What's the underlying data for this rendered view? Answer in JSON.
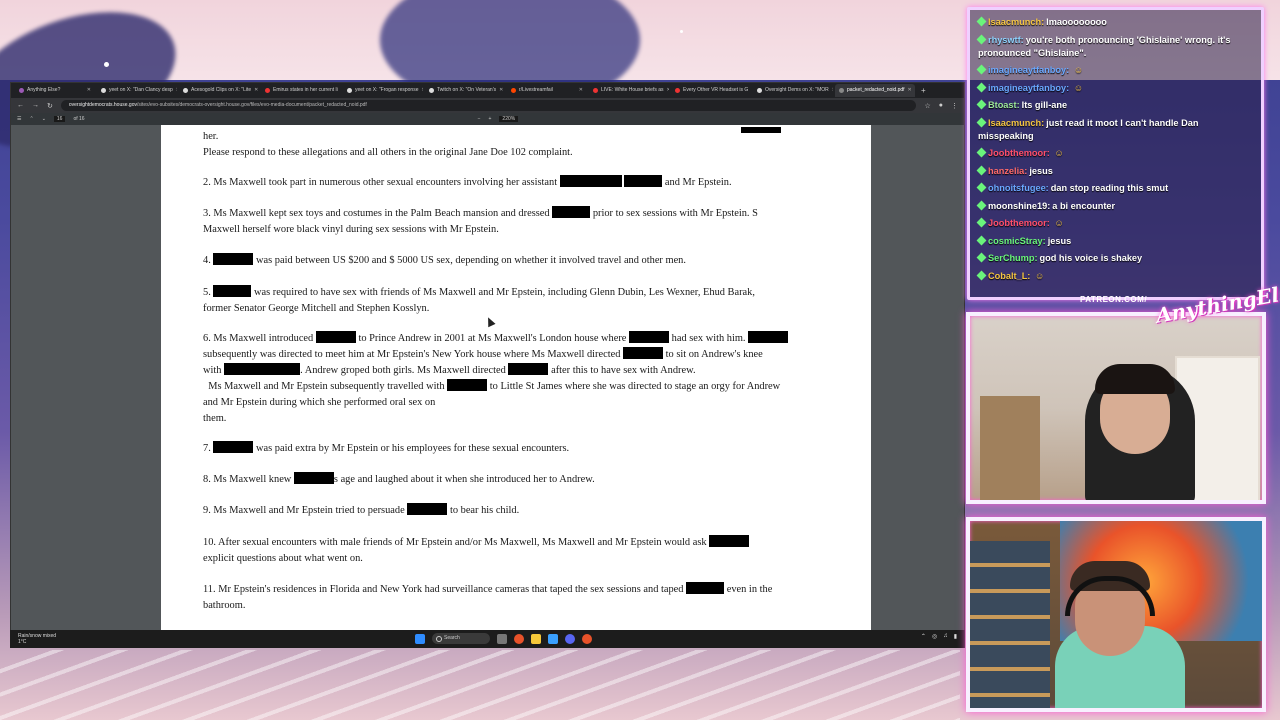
{
  "browser": {
    "tabs": [
      {
        "label": "Anything Else?",
        "color": "#9b59b6"
      },
      {
        "label": "yeet on X: \"Dan Clancy desp",
        "color": "#ddd"
      },
      {
        "label": "Acesogold Clips on X: \"Lite",
        "color": "#ddd"
      },
      {
        "label": "Emirus states in her current li",
        "color": "#e33"
      },
      {
        "label": "yeet on X: \"Frogan response",
        "color": "#ddd"
      },
      {
        "label": "Twitch on X: \"On Veteran's",
        "color": "#ddd"
      },
      {
        "label": "r/Livestreamfail",
        "color": "#ff4500"
      },
      {
        "label": "LIVE: White House briefs as",
        "color": "#e33"
      },
      {
        "label": "Every Other VR Headset is G",
        "color": "#e33"
      },
      {
        "label": "Oversight Dems on X: \"MOR",
        "color": "#ddd"
      },
      {
        "label": "packet_redacted_noid.pdf",
        "color": "#888"
      }
    ],
    "url_domain": "oversightdemocrats.house.gov",
    "url_path": "/sites/evo-subsites/democrats-oversight.house.gov/files/evo-media-document/packet_redacted_noid.pdf",
    "page_current": "16",
    "page_total": "of 16",
    "zoom": "220%"
  },
  "document": {
    "p0a": "her.",
    "p0b": "Please respond to these allegations and all others in the original Jane Doe 102 complaint.",
    "p2a": "2.  Ms Maxwell took part in numerous other sexual encounters involving her assistant",
    "p2b": "and Mr Epstein.",
    "p3a": "3.  Ms Maxwell kept sex toys and costumes in the Palm Beach mansion and dressed",
    "p3b": "prior to sex sessions with Mr Epstein. S",
    "p3c": "Maxwell herself wore black vinyl during sex sessions with Mr Epstein.",
    "p4a": "4.",
    "p4b": "was paid between US $200 and $ 5000 US sex, depending on whether it involved travel and other men.",
    "p5a": "5.",
    "p5b": "was required to have sex with friends of Ms Maxwell  and Mr Epstein, including Glenn Dubin, Les Wexner, Ehud Barak,",
    "p5c": "former Senator George Mitchell and Stephen Kosslyn.",
    "p6a": "6. Ms Maxwell introduced",
    "p6b": "to Prince Andrew in 2001 at Ms Maxwell's London house where",
    "p6c": "had sex with him.",
    "p6d": "subsequently was directed to meet him at Mr Epstein's New York  house where Ms Maxwell directed",
    "p6e": "to sit on Andrew's knee",
    "p6f": "with",
    "p6g": ". Andrew groped both girls. Ms Maxwell directed",
    "p6h": "after this to have sex with Andrew.",
    "p6i": "Ms Maxwell and Mr Epstein subsequently travelled with",
    "p6j": "to Little St James where she was directed to stage an orgy for Andrew",
    "p6k": "and Mr Epstein during which she performed oral sex on",
    "p6l": "them.",
    "p7a": "7.",
    "p7b": "was paid extra by Mr Epstein or his employees for these sexual encounters.",
    "p8a": "8. Ms Maxwell knew",
    "p8b": "s age and laughed about it when she introduced her to Andrew.",
    "p9a": "9. Ms Maxwell and Mr Epstein tried to persuade",
    "p9b": "to bear his child.",
    "p10a": "10.  After sexual encounters with male friends of Mr Epstein and/or Ms Maxwell, Ms Maxwell and Mr Epstein would ask",
    "p10b": "explicit questions about what went on.",
    "p11a": "11.  Mr Epstein's residences in Florida and New York had surveillance cameras that taped the sex sessions and taped",
    "p11b": "even in the",
    "p11c": "bathroom."
  },
  "taskbar": {
    "weather_line1": "Rain/snow mixed",
    "weather_line2": "1°C",
    "search_placeholder": "Search"
  },
  "chat": [
    {
      "user": "Isaacmunch:",
      "text": "lmaoooooooo",
      "color": "#f5c542"
    },
    {
      "user": "rhyswtf:",
      "text": "you're both pronouncing 'Ghislaine' wrong. it's pronounced \"Ghislaine\".",
      "color": "#8fd3ff"
    },
    {
      "user": "imagineaytfanboy:",
      "text": "",
      "color": "#6aa8ff"
    },
    {
      "user": "imagineaytfanboy:",
      "text": "",
      "color": "#6aa8ff"
    },
    {
      "user": "Btoast:",
      "text": "Its gill-ane",
      "color": "#9ee89a"
    },
    {
      "user": "Isaacmunch:",
      "text": "just read it moot I can't handle Dan misspeaking",
      "color": "#f5c542"
    },
    {
      "user": "Joobthemoor:",
      "text": "",
      "color": "#ff4f6b"
    },
    {
      "user": "hanzelia:",
      "text": "jesus",
      "color": "#ff6b6b"
    },
    {
      "user": "ohnoitsfugee:",
      "text": "dan stop reading this smut",
      "color": "#6aa8ff"
    },
    {
      "user": "moonshine19:",
      "text": "a bi encounter",
      "color": "#ffffff"
    },
    {
      "user": "Joobthemoor:",
      "text": "",
      "color": "#ff4f6b"
    },
    {
      "user": "cosmicStray:",
      "text": "jesus",
      "color": "#6af47b"
    },
    {
      "user": "SerChump:",
      "text": "god his voice is shakey",
      "color": "#6af47b"
    },
    {
      "user": "Cobalt_L:",
      "text": "",
      "color": "#f5c542"
    }
  ],
  "overlay": {
    "banner": "PATREON.COM/",
    "logo": "AnythingElse?"
  }
}
